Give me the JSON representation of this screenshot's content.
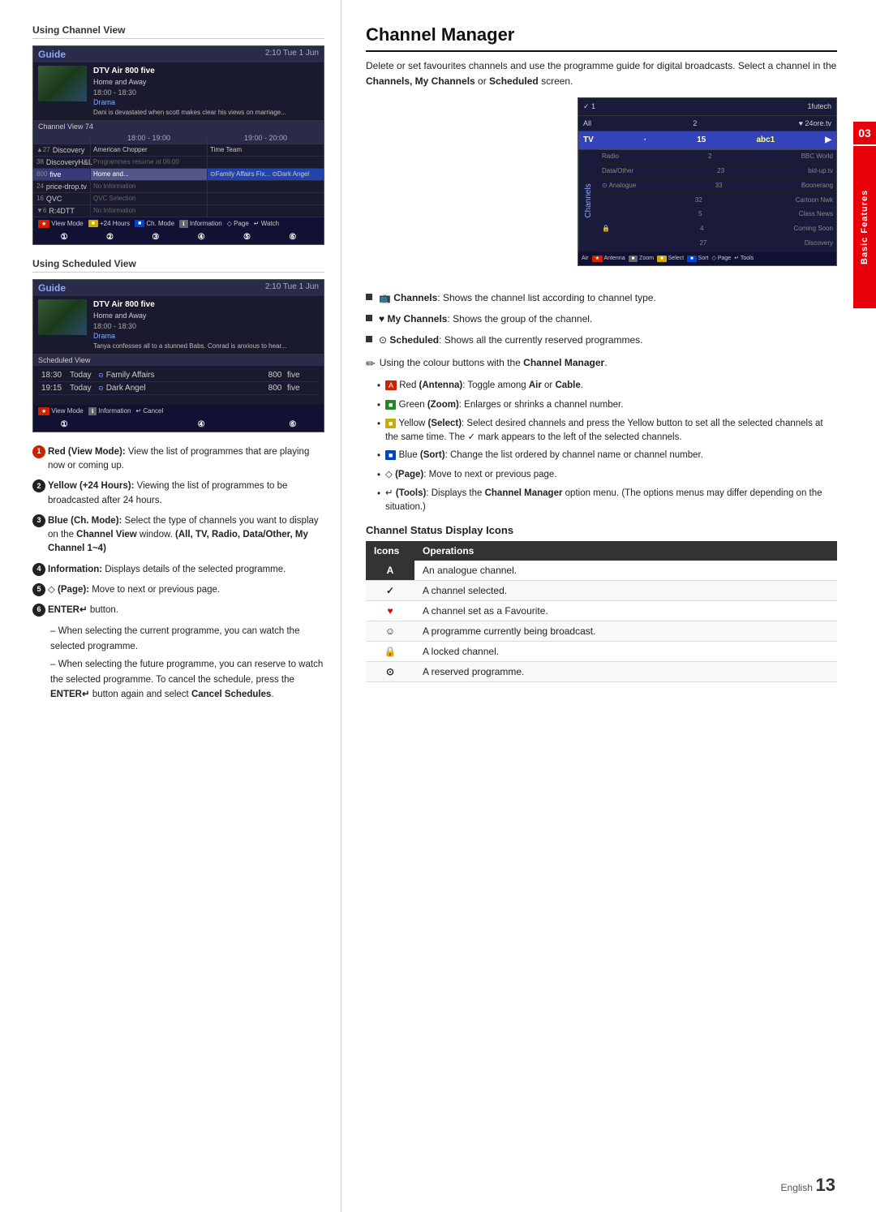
{
  "side_tab": {
    "number": "03",
    "label": "Basic Features"
  },
  "left_section": {
    "using_channel_view_title": "Using Channel View",
    "using_scheduled_view_title": "Using Scheduled View",
    "guide_header_title": "Guide",
    "guide_time": "2:10 Tue 1 Jun",
    "guide_preview": {
      "title": "DTV Air 800 five",
      "subtitle": "Home and Away",
      "time": "18:00 - 18:30",
      "genre": "Drama",
      "desc": "Dani is devastated when scott makes clear his views on marriage..."
    },
    "guide_label_channel_view": "Channel View 74",
    "guide_time_slots": [
      "18:00 - 19:00",
      "19:00 - 20:00"
    ],
    "guide_channels": [
      {
        "num": "▲ 27",
        "name": "Discovery",
        "slots": [
          "American Chopper",
          "Time Team"
        ],
        "selected": false
      },
      {
        "num": "38",
        "name": "DiscoveryH&L",
        "slots": [
          "Programmes resume at 06:00",
          ""
        ],
        "selected": false
      },
      {
        "num": "800",
        "name": "five",
        "slots": [
          "Home and...",
          "⊙Family Affairs  Fix...  ⊙Dark Angel"
        ],
        "selected": true
      },
      {
        "num": "24",
        "name": "price-drop.tv",
        "slots": [
          "No Information",
          ""
        ],
        "selected": false
      },
      {
        "num": "16",
        "name": "QVC",
        "slots": [
          "QVC Selection",
          ""
        ],
        "selected": false
      },
      {
        "num": "▼ 6",
        "name": "R:4DTT",
        "slots": [
          "No Information",
          ""
        ],
        "selected": false
      }
    ],
    "guide_footer_items": [
      {
        "color": "red",
        "label": "★ View Mode"
      },
      {
        "color": "yellow",
        "label": "■ +24 Hours"
      },
      {
        "color": "blue",
        "label": "■ Ch. Mode"
      },
      {
        "color": "white",
        "label": "ℹ Information"
      },
      {
        "label": "◇ Page"
      },
      {
        "label": "↵ Watch"
      }
    ],
    "scheduled_preview_label": "Scheduled View",
    "scheduled_channels": [
      {
        "time": "18:30",
        "day": "Today",
        "prog": "⊙Family Affairs",
        "ch": "800",
        "name": "five"
      },
      {
        "time": "19:15",
        "day": "Today",
        "prog": "⊙Dark Angel",
        "ch": "800",
        "name": "five"
      }
    ],
    "scheduled_footer_items": [
      {
        "color": "red",
        "label": "★ View Mode"
      },
      {
        "color": "white",
        "label": "ℹ Information"
      },
      {
        "label": "↵ Cancel"
      }
    ],
    "bullet_items": [
      {
        "num": "1",
        "color": "red",
        "text": "Red (View Mode): View the list of programmes that are playing now or coming up."
      },
      {
        "num": "2",
        "color": "dark",
        "text": "Yellow (+24 Hours): Viewing the list of programmes to be broadcasted after 24 hours."
      },
      {
        "num": "3",
        "color": "dark",
        "text": "Blue (Ch. Mode): Select the type of channels you want to display on the Channel View window. (All, TV, Radio, Data/Other, My Channel 1~4)"
      },
      {
        "num": "4",
        "color": "dark",
        "text": "Information: Displays details of the selected programme."
      },
      {
        "num": "5",
        "color": "dark",
        "text": "◇ (Page): Move to next or previous page."
      },
      {
        "num": "6",
        "color": "dark",
        "text": "ENTER↵ button."
      }
    ],
    "enter_sub_bullets": [
      "– When selecting the current programme, you can watch the selected programme.",
      "– When selecting the future programme, you can reserve to watch the selected programme. To cancel the schedule, press the ENTER↵ button again and select Cancel Schedules."
    ]
  },
  "right_section": {
    "title": "Channel Manager",
    "intro": "Delete or set favourites channels and use the programme guide for digital broadcasts. Select a channel in the Channels, My Channels or Scheduled screen.",
    "cm_screen": {
      "header_cols": [
        "✓ 1",
        "1futech"
      ],
      "all_label": "All",
      "all_num": "2",
      "all_extra": "♥ 24ore.tv",
      "tv_label": "TV",
      "tv_dot": "·",
      "tv_num": "15",
      "tv_channel": "abc1",
      "sidebar_items": [
        {
          "icon": "📺",
          "label": "Channels",
          "active": false
        },
        {
          "icon": "♥",
          "label": "",
          "active": false
        },
        {
          "icon": "⊙",
          "label": "",
          "active": false
        }
      ],
      "channels_label": "Channels",
      "channel_rows": [
        {
          "icon": "",
          "num": "",
          "name": "Radio",
          "num2": "2",
          "extra": "BBC World"
        },
        {
          "icon": "",
          "num": "",
          "name": "Data/Other",
          "num2": "23",
          "extra": "bid-up.tv"
        },
        {
          "icon": "⊙",
          "num": "",
          "name": "Analogue",
          "num2": "33",
          "extra": "Boonerang"
        },
        {
          "icon": "",
          "num": "",
          "name": "",
          "num2": "32",
          "extra": "Cartoon Nwk"
        },
        {
          "icon": "",
          "num": "",
          "name": "",
          "num2": "5",
          "extra": "Class News"
        },
        {
          "icon": "🔒",
          "num": "",
          "name": "",
          "num2": "4",
          "extra": "Coming Soon"
        },
        {
          "icon": "",
          "num": "",
          "name": "",
          "num2": "27",
          "extra": "Discovery"
        }
      ],
      "footer_items": [
        "Air",
        "★ Antenna",
        "■ Zoom",
        "■ Select",
        "■ Sort",
        "◇ Page",
        "↵ Tools"
      ]
    },
    "main_bullets": [
      {
        "symbol": "■",
        "text": "Channels: Shows the channel list according to channel type."
      },
      {
        "symbol": "■",
        "text": "My Channels: Shows the group of the channel."
      },
      {
        "symbol": "■",
        "text": "Scheduled: Shows all the currently reserved programmes."
      }
    ],
    "pencil_note": "Using the colour buttons with the Channel Manager.",
    "sub_bullets": [
      {
        "color": "red",
        "text": "Red (Antenna): Toggle among Air or Cable."
      },
      {
        "color": "green",
        "text": "Green (Zoom): Enlarges or shrinks a channel number."
      },
      {
        "color": "yellow",
        "text": "Yellow (Select): Select desired channels and press the Yellow button to set all the selected channels at the same time. The ✓ mark appears to the left of the selected channels."
      },
      {
        "color": "blue",
        "text": "Blue (Sort): Change the list ordered by channel name or channel number."
      },
      {
        "color": "none",
        "text": "◇ (Page): Move to next or previous page."
      },
      {
        "color": "none",
        "text": "↵ (Tools): Displays the Channel Manager option menu. (The options menus may differ depending on the situation.)"
      }
    ],
    "csd_title": "Channel Status Display Icons",
    "csd_table": {
      "headers": [
        "Icons",
        "Operations"
      ],
      "rows": [
        {
          "icon": "A",
          "operation": "An analogue channel."
        },
        {
          "icon": "✓",
          "operation": "A channel selected."
        },
        {
          "icon": "♥",
          "operation": "A channel set as a Favourite."
        },
        {
          "icon": "☺",
          "operation": "A programme currently being broadcast."
        },
        {
          "icon": "🔒",
          "operation": "A locked channel."
        },
        {
          "icon": "⊙",
          "operation": "A reserved programme."
        }
      ]
    }
  },
  "page_footer": {
    "lang": "English",
    "num": "13"
  }
}
